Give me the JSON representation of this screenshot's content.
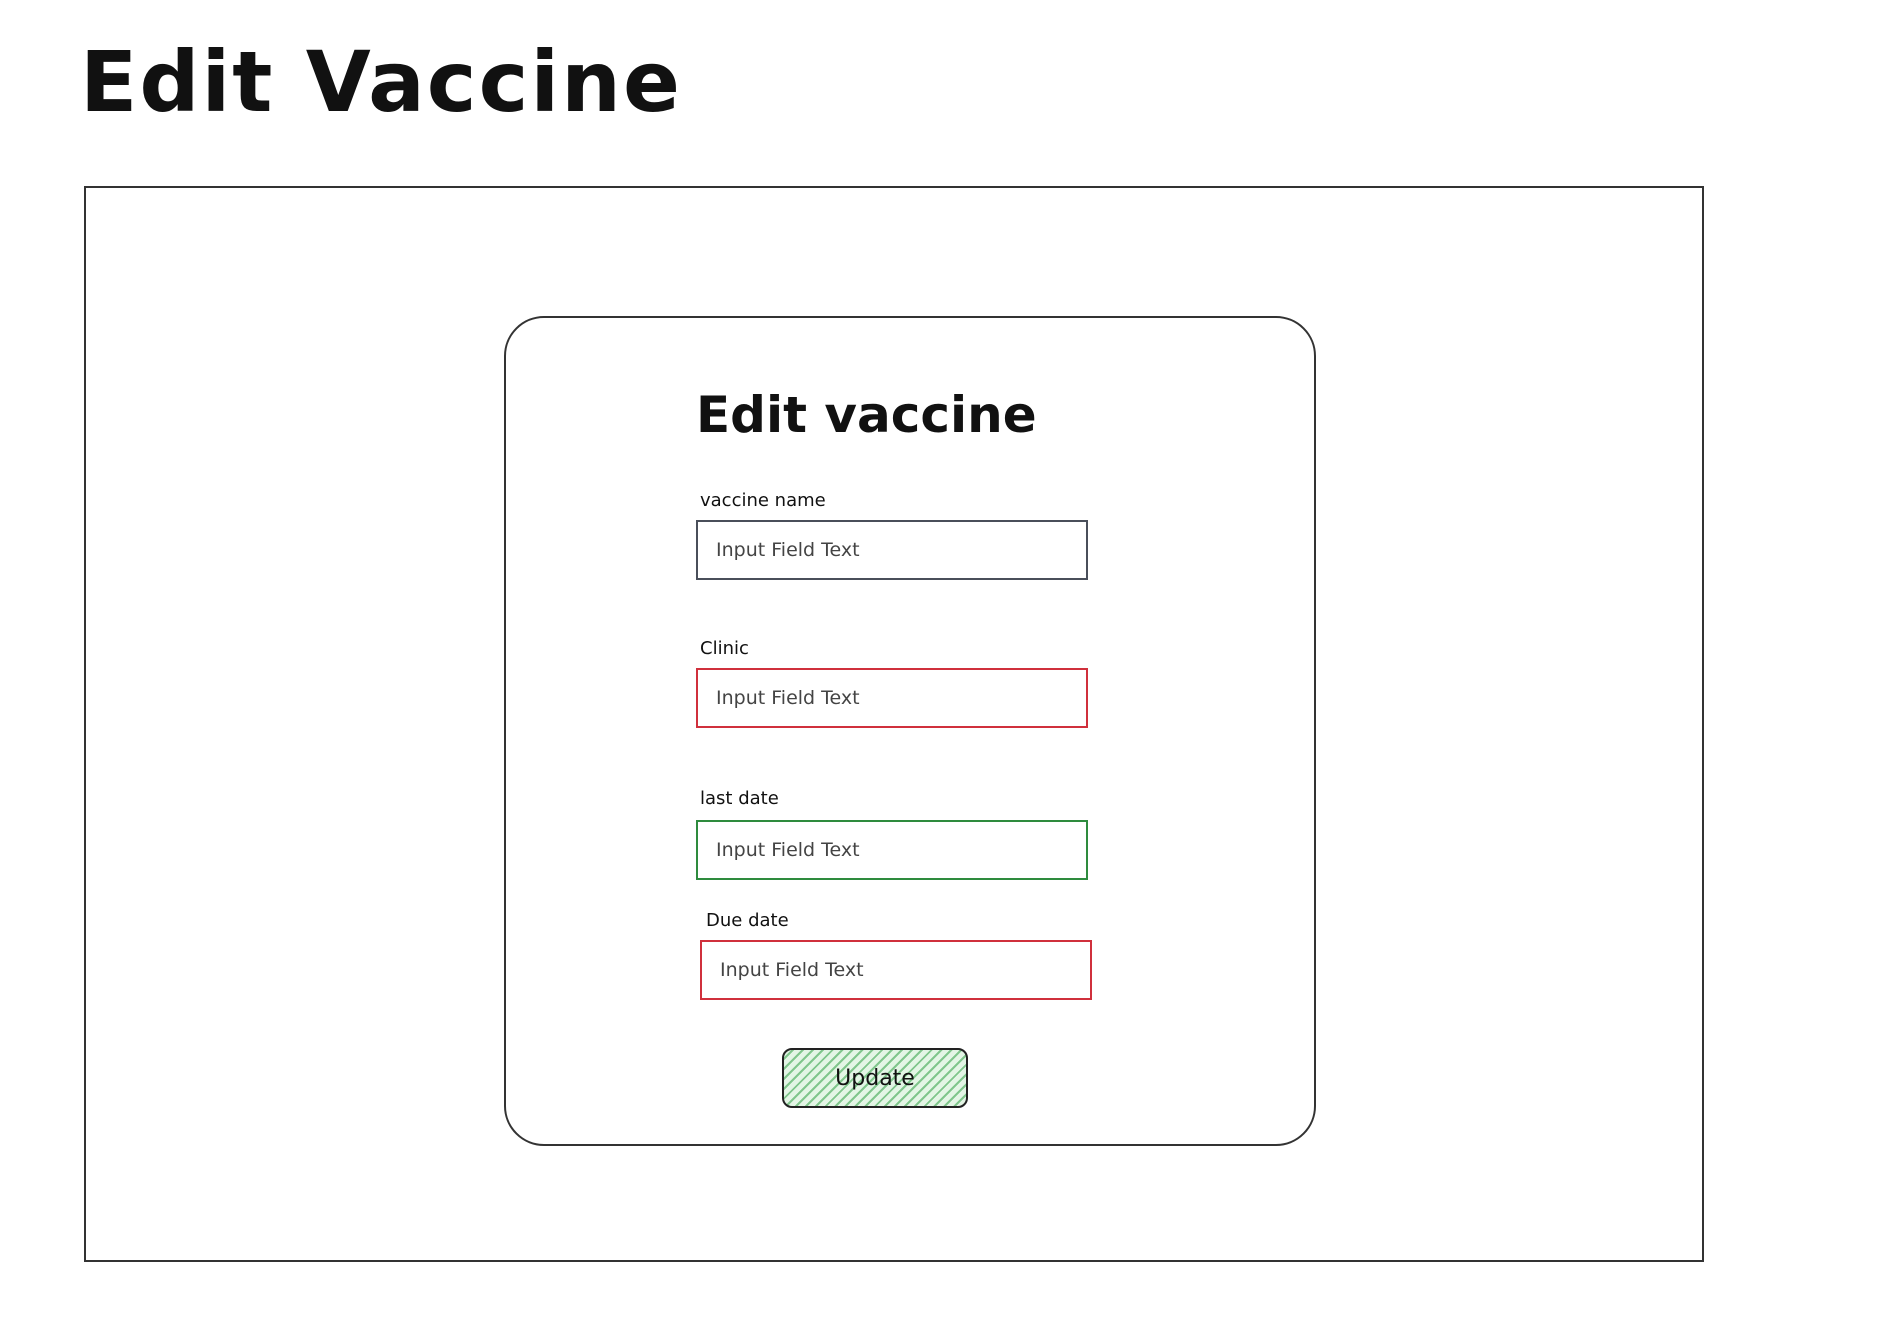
{
  "page": {
    "title": "Edit Vaccine"
  },
  "form": {
    "title": "Edit vaccine",
    "fields": [
      {
        "label": "vaccine name",
        "placeholder": "Input Field Text",
        "state": "neutral"
      },
      {
        "label": "Clinic",
        "placeholder": "Input Field Text",
        "state": "error"
      },
      {
        "label": "last date",
        "placeholder": "Input Field Text",
        "state": "success"
      },
      {
        "label": "Due date",
        "placeholder": "Input Field Text",
        "state": "error"
      }
    ],
    "submit_label": "Update"
  },
  "colors": {
    "neutral_border": "#4a4f5a",
    "error_border": "#d0303c",
    "success_border": "#2e8b3e",
    "button_fill": "#2ea043"
  }
}
